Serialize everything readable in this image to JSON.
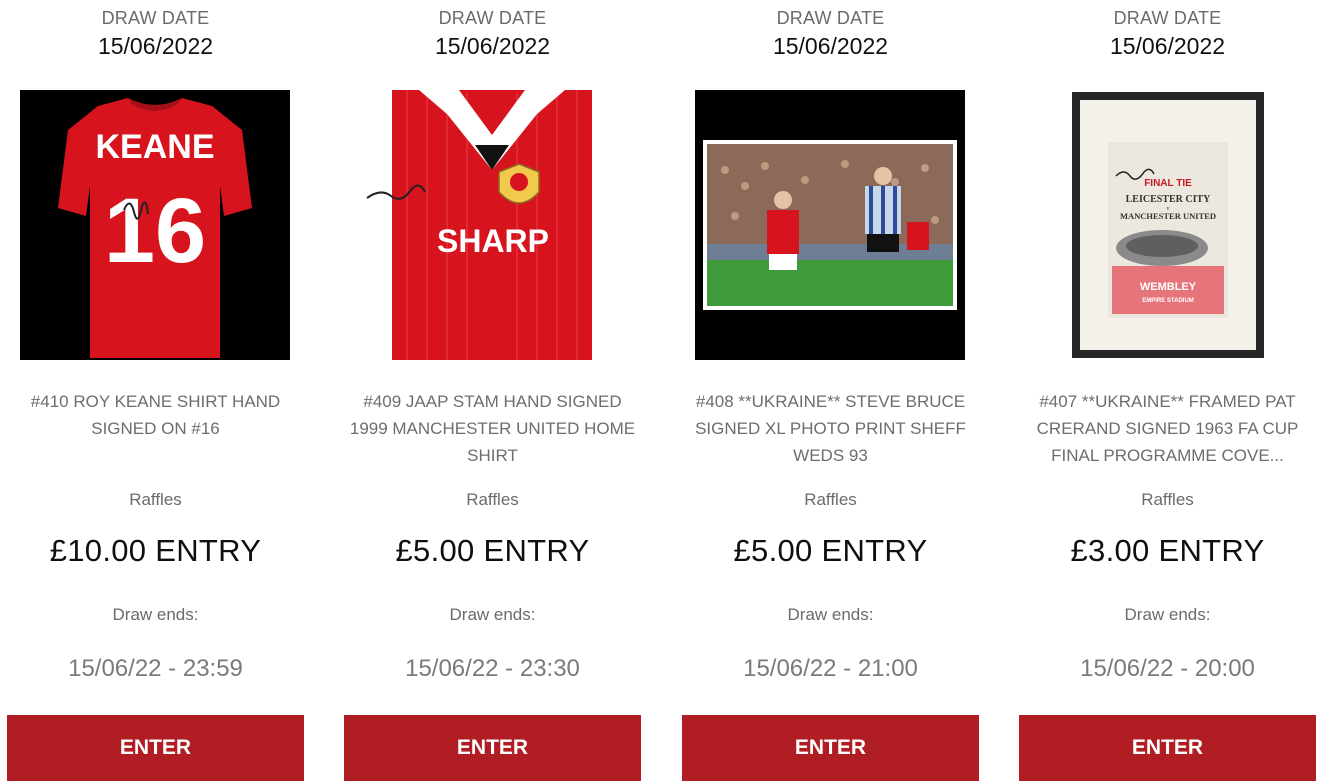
{
  "cards": [
    {
      "draw_label": "DRAW DATE",
      "draw_date": "15/06/2022",
      "image_alt": "Roy Keane signed shirt #16",
      "title_lines": [
        "#410 ROY KEANE SHIRT HAND",
        "SIGNED ON #16",
        ""
      ],
      "category": "Raffles",
      "price": "£10.00 ENTRY",
      "ends_label": "Draw ends:",
      "ends_time": "15/06/22 - 23:59",
      "button": "ENTER",
      "shirt_name": "KEANE",
      "shirt_number": "16"
    },
    {
      "draw_label": "DRAW DATE",
      "draw_date": "15/06/2022",
      "image_alt": "Jaap Stam signed 1999 home shirt",
      "title_lines": [
        "#409 JAAP STAM HAND SIGNED",
        "1999 MANCHESTER UNITED HOME",
        "SHIRT"
      ],
      "category": "Raffles",
      "price": "£5.00 ENTRY",
      "ends_label": "Draw ends:",
      "ends_time": "15/06/22 - 23:30",
      "button": "ENTER",
      "sponsor": "SHARP"
    },
    {
      "draw_label": "DRAW DATE",
      "draw_date": "15/06/2022",
      "image_alt": "Steve Bruce signed photo print",
      "title_lines": [
        "#408 **UKRAINE** STEVE BRUCE",
        "SIGNED XL PHOTO PRINT SHEFF",
        "WEDS 93"
      ],
      "category": "Raffles",
      "price": "£5.00 ENTRY",
      "ends_label": "Draw ends:",
      "ends_time": "15/06/22 - 21:00",
      "button": "ENTER"
    },
    {
      "draw_label": "DRAW DATE",
      "draw_date": "15/06/2022",
      "image_alt": "Framed signed 1963 FA Cup final programme",
      "title_lines": [
        "#407 **UKRAINE** FRAMED PAT",
        "CRERAND SIGNED 1963 FA CUP",
        "FINAL PROGRAMME COVE..."
      ],
      "category": "Raffles",
      "price": "£3.00 ENTRY",
      "ends_label": "Draw ends:",
      "ends_time": "15/06/22 - 20:00",
      "button": "ENTER",
      "programme": {
        "heading": "FINAL TIE",
        "team1": "LEICESTER CITY",
        "vs": "v",
        "team2": "MANCHESTER UNITED",
        "venue": "WEMBLEY",
        "stadium": "EMPIRE STADIUM"
      }
    }
  ],
  "colors": {
    "button_bg": "#b01d23",
    "shirt_red": "#d7141e"
  }
}
